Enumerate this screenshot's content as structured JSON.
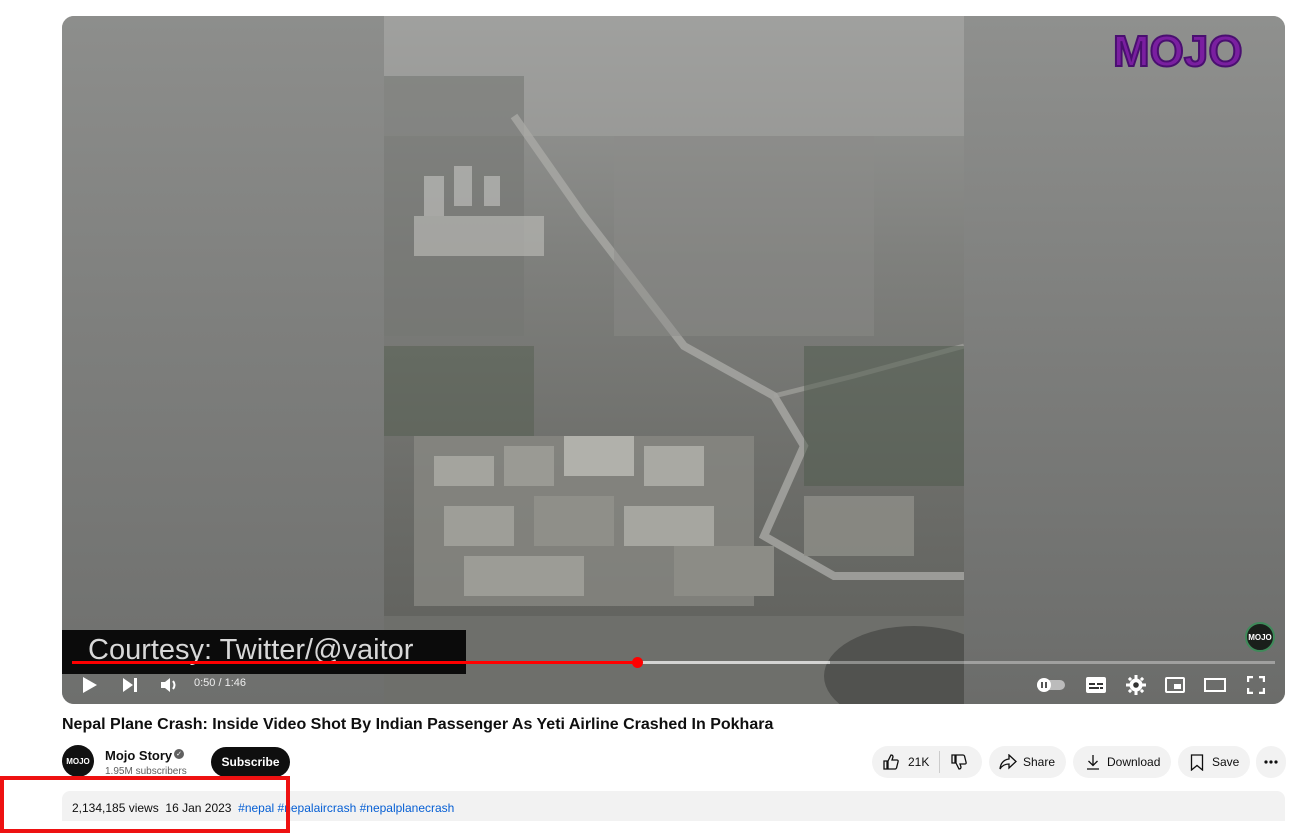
{
  "video": {
    "watermark": "MOJO",
    "corner_badge": "MOJO",
    "caption": "Courtesy: Twitter/@vaitor",
    "progress_fraction": 0.47,
    "buffered_fraction": 0.63,
    "time": "0:50 / 1:46"
  },
  "controls": {
    "play_icon": "play-icon",
    "next_icon": "next-icon",
    "volume_icon": "volume-icon",
    "autoplay_icon": "autoplay-toggle-icon",
    "captions_icon": "captions-icon",
    "settings_icon": "gear-icon",
    "miniplayer_icon": "miniplayer-icon",
    "theater_icon": "theater-icon",
    "fullscreen_icon": "fullscreen-icon"
  },
  "title": "Nepal Plane Crash: Inside Video Shot By Indian Passenger As Yeti Airline Crashed In Pokhara",
  "channel": {
    "avatar_text": "MOJO",
    "name": "Mojo Story",
    "subscribers": "1.95M subscribers",
    "subscribe_label": "Subscribe"
  },
  "actions": {
    "likes": "21K",
    "share": "Share",
    "download": "Download",
    "save": "Save"
  },
  "description": {
    "views": "2,134,185 views",
    "date": "16 Jan 2023",
    "tags": [
      "#nepal",
      "#nepalaircrash",
      "#nepalplanecrash"
    ]
  },
  "colors": {
    "progress": "#ff0000",
    "highlight_box": "#ee1111",
    "link": "#065fd4"
  }
}
